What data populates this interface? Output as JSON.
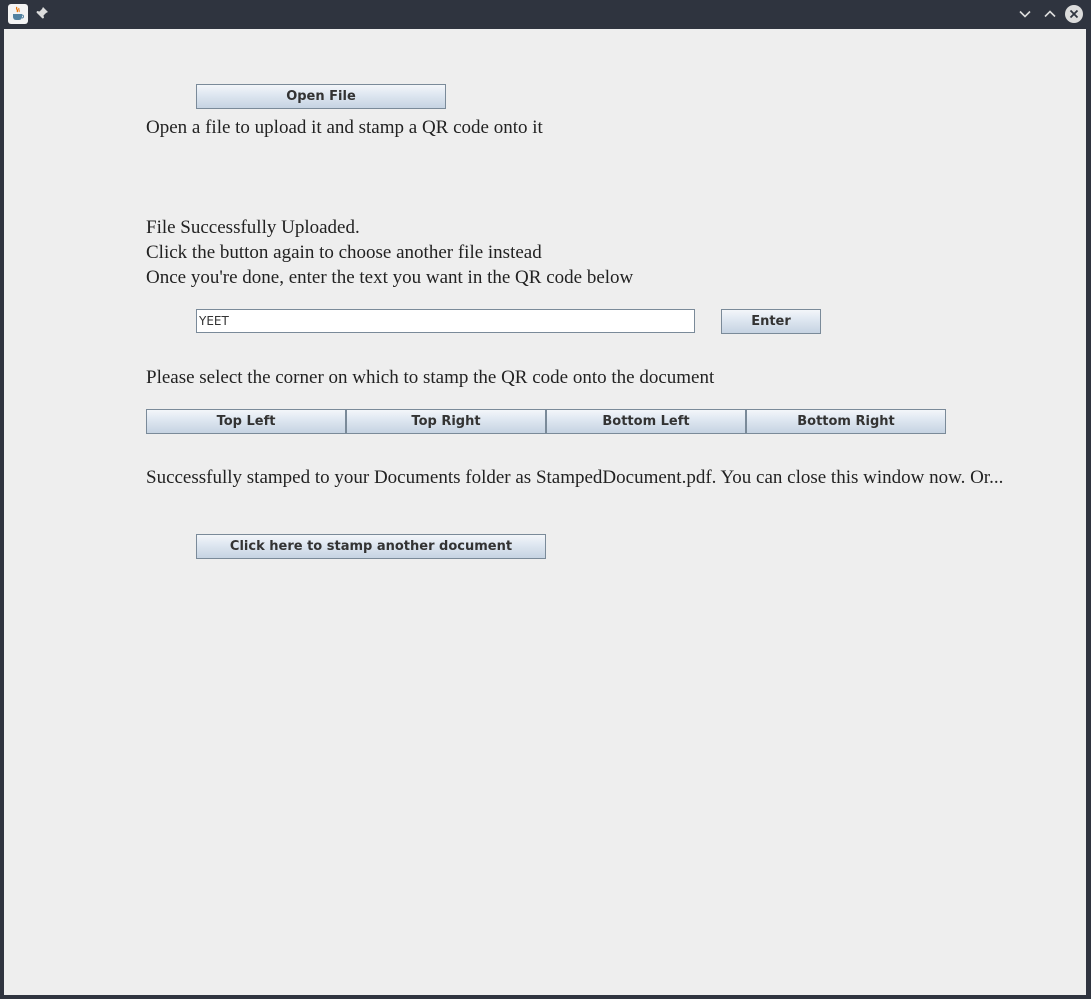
{
  "titlebar": {
    "app_icon": "java-cup-icon",
    "pin_icon": "pin-icon",
    "minimize_icon": "chevron-down-icon",
    "maximize_icon": "chevron-up-icon",
    "close_icon": "close-icon"
  },
  "main": {
    "open_file_button": "Open File",
    "open_file_hint": "Open a file to upload it and stamp a QR code onto it",
    "upload_status": [
      "File Successfully Uploaded.",
      "Click the button again to choose another file instead",
      "Once you're done, enter the text you want in the QR code below"
    ],
    "qr_text_value": "YEET",
    "enter_button": "Enter",
    "corner_prompt": "Please select the corner on which to stamp the QR code onto the document",
    "corner_buttons": [
      "Top Left",
      "Top Right",
      "Bottom Left",
      "Bottom Right"
    ],
    "success_message": "Successfully stamped to your Documents folder as StampedDocument.pdf. You can close this window now. Or...",
    "stamp_another_button": "Click here to stamp another document"
  },
  "colors": {
    "titlebar_bg": "#2f343f",
    "content_bg": "#eeeeee",
    "button_border": "#7a8a99"
  }
}
